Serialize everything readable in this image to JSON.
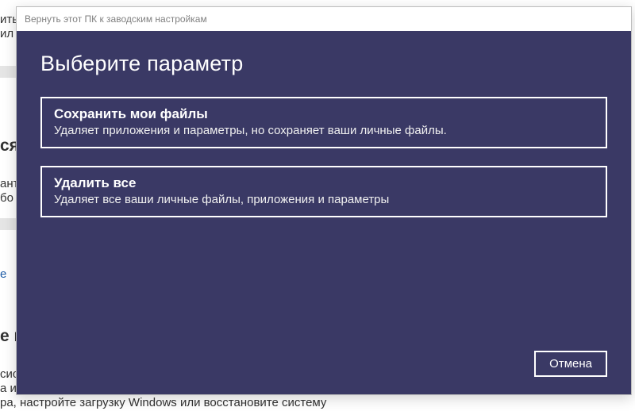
{
  "modal": {
    "window_title": "Вернуть этот ПК к заводским настройкам",
    "heading": "Выберите параметр",
    "options": [
      {
        "title": "Сохранить мои файлы",
        "description": "Удаляет приложения и параметры, но сохраняет ваши личные файлы."
      },
      {
        "title": "Удалить все",
        "description": "Удаляет все ваши личные файлы, приложения и параметры"
      }
    ],
    "cancel_label": "Отмена"
  },
  "background_fragments": {
    "f1": "ить",
    "f2": "ил",
    "f3": "ся",
    "f4": "ант",
    "f5": "бо",
    "f6": "е",
    "f7": "е в",
    "f8": "сис",
    "f9": "а и",
    "f10": "ра, настройте загрузку Windows или восстановите систему"
  }
}
